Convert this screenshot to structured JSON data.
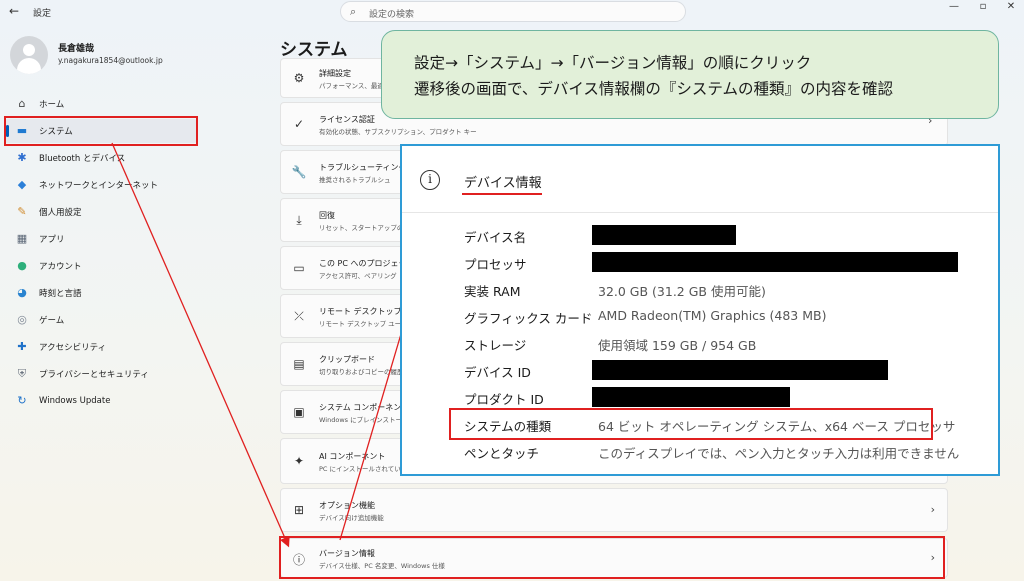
{
  "titlebar": {
    "back": "←",
    "app_title": "設定",
    "search_placeholder": "設定の検索",
    "minimize": "—",
    "maximize": "▫",
    "close": "✕"
  },
  "user": {
    "name": "長倉雄哉",
    "email": "y.nagakura1854@outlook.jp"
  },
  "sidebar": {
    "items": [
      {
        "label": "ホーム",
        "icon": "home-icon",
        "glyph": "⌂",
        "color": "#444444"
      },
      {
        "label": "システム",
        "icon": "system-icon",
        "glyph": "▬",
        "color": "#1f7ad1",
        "active": true
      },
      {
        "label": "Bluetooth とデバイス",
        "icon": "bluetooth-icon",
        "glyph": "✱",
        "color": "#2f6fd0"
      },
      {
        "label": "ネットワークとインターネット",
        "icon": "network-icon",
        "glyph": "◆",
        "color": "#2b7fd8"
      },
      {
        "label": "個人用設定",
        "icon": "brush-icon",
        "glyph": "✎",
        "color": "#d08a2c"
      },
      {
        "label": "アプリ",
        "icon": "apps-icon",
        "glyph": "▦",
        "color": "#5a6575"
      },
      {
        "label": "アカウント",
        "icon": "account-icon",
        "glyph": "●",
        "color": "#2eaf7b"
      },
      {
        "label": "時刻と言語",
        "icon": "clock-globe-icon",
        "glyph": "◕",
        "color": "#2a84d0"
      },
      {
        "label": "ゲーム",
        "icon": "gamepad-icon",
        "glyph": "◎",
        "color": "#7b8592"
      },
      {
        "label": "アクセシビリティ",
        "icon": "accessibility-icon",
        "glyph": "✚",
        "color": "#1f72c9"
      },
      {
        "label": "プライバシーとセキュリティ",
        "icon": "shield-icon",
        "glyph": "⛨",
        "color": "#6b7480"
      },
      {
        "label": "Windows Update",
        "icon": "update-icon",
        "glyph": "↻",
        "color": "#1f72c9"
      }
    ]
  },
  "main": {
    "title": "システム",
    "cards": [
      {
        "title": "詳細設定",
        "subtitle": "パフォーマンス、最適",
        "icon": "advanced-settings-icon",
        "glyph": "⚙"
      },
      {
        "title": "ライセンス認証",
        "subtitle": "有効化の状態、サブスクリプション、プロダクト キー",
        "icon": "check-circle-icon",
        "glyph": "✓"
      },
      {
        "title": "トラブルシューティング",
        "subtitle": "推奨されるトラブルシュ",
        "icon": "wrench-icon",
        "glyph": "🔧"
      },
      {
        "title": "回復",
        "subtitle": "リセット、スタートアップの詳",
        "icon": "recovery-icon",
        "glyph": "⤓"
      },
      {
        "title": "この PC へのプロジェク",
        "subtitle": "アクセス許可、ペアリング",
        "icon": "projection-icon",
        "glyph": "▭"
      },
      {
        "title": "リモート デスクトップ",
        "subtitle": "リモート デスクトップ ユーザ",
        "icon": "remote-desktop-icon",
        "glyph": "⤫"
      },
      {
        "title": "クリップボード",
        "subtitle": "切り取りおよびコピーの履歴",
        "icon": "clipboard-icon",
        "glyph": "▤"
      },
      {
        "title": "システム コンポーネント",
        "subtitle": "Windows にプレインストー",
        "icon": "component-icon",
        "glyph": "▣"
      },
      {
        "title": "AI コンポーネント",
        "subtitle": "PC にインストールされてい",
        "icon": "sparkle-icon",
        "glyph": "✦"
      },
      {
        "title": "オプション機能",
        "subtitle": "デバイス向け追加機能",
        "icon": "optional-features-icon",
        "glyph": "⊞",
        "chevron": "›"
      },
      {
        "title": "バージョン情報",
        "subtitle": "デバイス仕様、PC 名変更、Windows 仕様",
        "icon": "info-icon",
        "glyph": "ⓘ",
        "chevron": "›"
      }
    ],
    "partial_chevron": "›"
  },
  "callout": {
    "line1": "設定→「システム」→「バージョン情報」の順にクリック",
    "line2": "遷移後の画面で、デバイス情報欄の『システムの種類』の内容を確認"
  },
  "device_info": {
    "title": "デバイス情報",
    "info_glyph": "i",
    "rows": [
      {
        "key": "デバイス名",
        "value": "",
        "redacted": true
      },
      {
        "key": "プロセッサ",
        "value": "",
        "redacted": true
      },
      {
        "key": "実装 RAM",
        "value": "32.0 GB (31.2 GB 使用可能)"
      },
      {
        "key": "グラフィックス カード",
        "value": "AMD Radeon(TM) Graphics (483 MB)"
      },
      {
        "key": "ストレージ",
        "value": "使用領域 159 GB / 954 GB"
      },
      {
        "key": "デバイス ID",
        "value": "",
        "redacted": true
      },
      {
        "key": "プロダクト ID",
        "value": "",
        "redacted": true
      },
      {
        "key": "システムの種類",
        "value": "64 ビット オペレーティング システム、x64 ベース プロセッサ",
        "highlight": true
      },
      {
        "key": "ペンとタッチ",
        "value": "このディスプレイでは、ペン入力とタッチ入力は利用できません"
      }
    ]
  },
  "colors": {
    "accent": "#005fb8",
    "annotation_red": "#e02020",
    "panel_border": "#2e9bd6",
    "callout_bg": "#e2f0d9"
  }
}
